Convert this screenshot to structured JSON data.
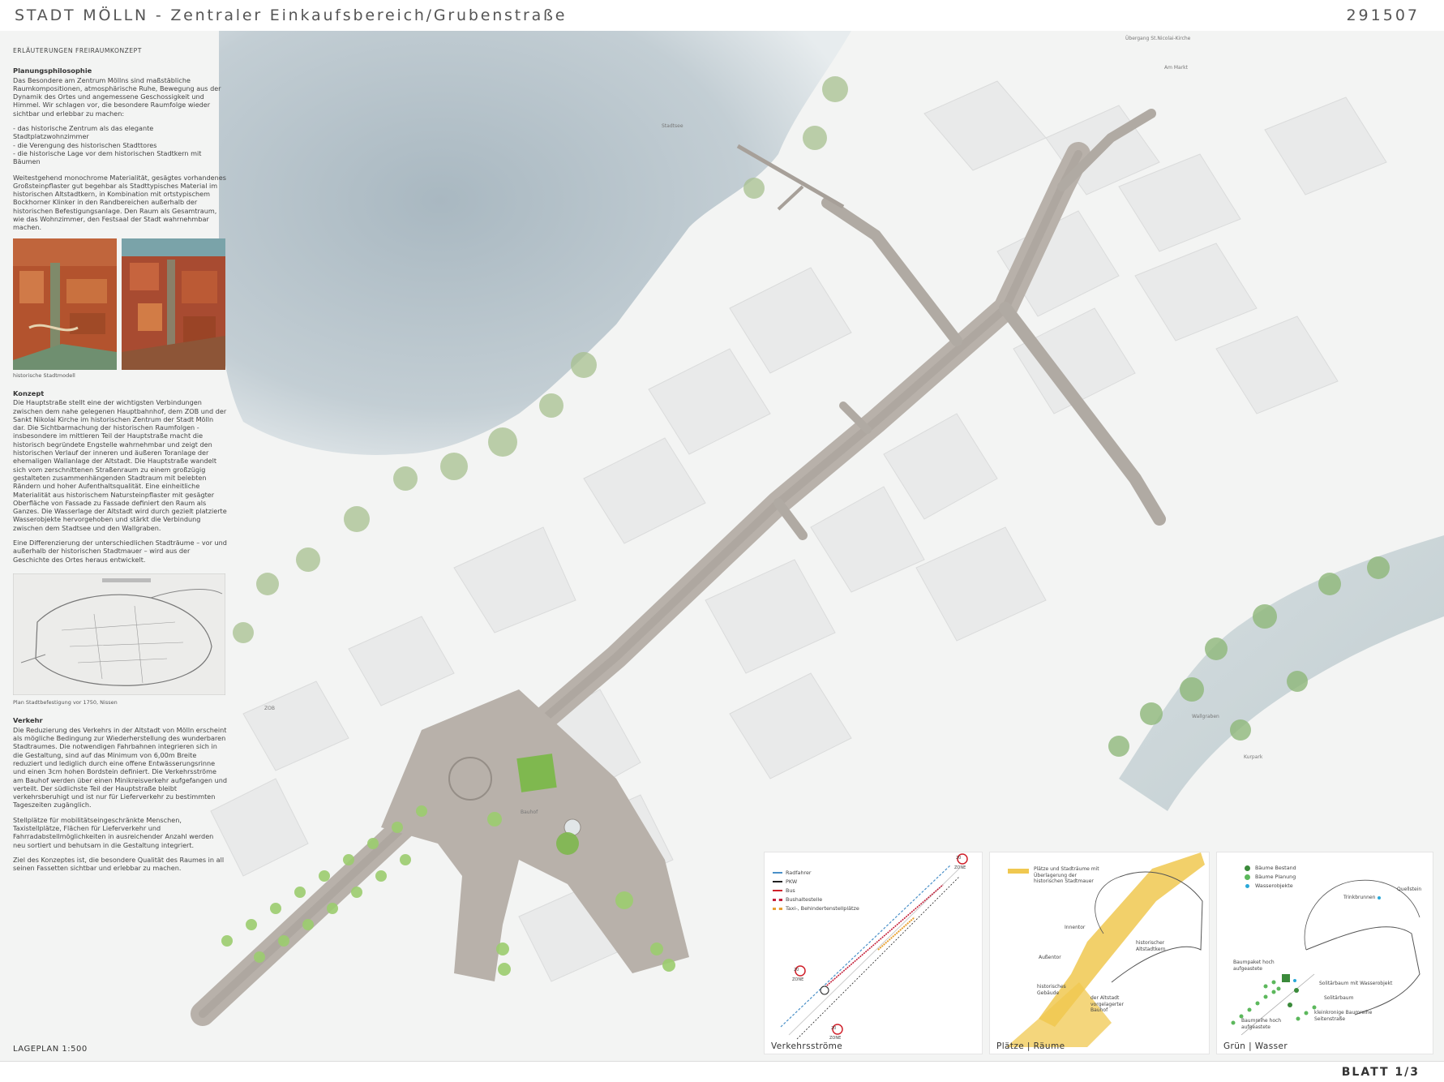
{
  "header": {
    "title": "STADT MÖLLN - Zentraler Einkaufsbereich/Grubenstraße",
    "project_number": "291507"
  },
  "footer": {
    "sheet": "BLATT 1/3",
    "plan_scale": "LAGEPLAN 1:500"
  },
  "text_panel": {
    "section_title": "ERLÄUTERUNGEN FREIRAUMKONZEPT",
    "philosophy_heading": "Planungsphilosophie",
    "philosophy_text": "Das Besondere am Zentrum Möllns sind maßstäbliche Raumkompositionen, atmosphärische Ruhe, Bewegung aus der Dynamik des Ortes und angemessene Geschossigkeit und Himmel. Wir schlagen vor, die besondere Raumfolge wieder sichtbar und erlebbar zu machen:",
    "bullet_1": "- das historische Zentrum als das elegante Stadtplatzwohnzimmer",
    "bullet_2": "- die Verengung des historischen Stadttores",
    "bullet_3": "- die historische Lage vor dem historischen Stadtkern mit Bäumen",
    "material_text": "Weitestgehend monochrome Materialität, gesägtes vorhandenes Großsteinpflaster gut begehbar als Stadttypisches Material im historischen Altstadtkern, in Kombination mit ortstypischem Bockhorner Klinker in den Randbereichen außerhalb der historischen Befestigungsanlage. Den Raum als Gesamtraum, wie das Wohnzimmer, den Festsaal der Stadt wahrnehmbar machen.",
    "photo_caption": "historische Stadtmodell",
    "concept_heading": "Konzept",
    "concept_text": "Die Hauptstraße stellt eine der wichtigsten Verbindungen zwischen dem nahe gelegenen Hauptbahnhof, dem ZOB und der Sankt Nikolai Kirche im historischen Zentrum der Stadt Mölln dar. Die Sichtbarmachung der historischen Raumfolgen - insbesondere im mittleren Teil der Hauptstraße macht die historisch begründete Engstelle wahrnehmbar und zeigt den historischen Verlauf der inneren und äußeren Toranlage der ehemaligen Wallanlage der Altstadt. Die Hauptstraße wandelt sich vom zerschnittenen Straßenraum zu einem großzügig gestalteten zusammenhängenden Stadtraum mit belebten Rändern und hoher Aufenthaltsqualität. Eine einheitliche Materialität aus historischem Natursteinpflaster mit gesägter Oberfläche von Fassade zu Fassade definiert den Raum als Ganzes. Die Wasserlage der Altstadt wird durch gezielt platzierte Wasserobjekte hervorgehoben und stärkt die Verbindung zwischen dem Stadtsee und den Wallgraben.",
    "differentiation_text": "Eine Differenzierung der unterschiedlichen Stadträume – vor und außerhalb der historischen Stadtmauer – wird aus der Geschichte des Ortes heraus entwickelt.",
    "plan_caption": "Plan Stadtbefestigung vor 1750, Nissen",
    "traffic_heading": "Verkehr",
    "traffic_text": "Die Reduzierung des Verkehrs in der Altstadt von Mölln erscheint als mögliche Bedingung zur Wiederherstellung des wunderbaren Stadtraumes. Die notwendigen Fahrbahnen integrieren sich in die Gestaltung, sind auf das Minimum von 6,00m Breite reduziert und lediglich durch eine offene Entwässerungsrinne und einen 3cm hohen Bordstein definiert. Die Verkehrsströme am Bauhof werden über einen Minikreisverkehr aufgefangen und verteilt. Der südlichste Teil der Hauptstraße bleibt verkehrsberuhigt und ist nur für Lieferverkehr zu bestimmten Tageszeiten zugänglich.",
    "parking_text": "Stellplätze für mobilitätseingeschränkte Menschen, Taxistellplätze, Flächen für Lieferverkehr und Fahrradabstellmöglichkeiten in ausreichender Anzahl werden neu sortiert und behutsam in die Gestaltung integriert.",
    "closing_text": "Ziel des Konzeptes ist, die besondere Qualität des Raumes in all seinen Fassetten sichtbar und erlebbar zu machen."
  },
  "map_labels": {
    "crossing": "Übergang St.Nicolai-Kirche",
    "market": "Am Markt",
    "lake": "Stadtsee",
    "zob": "ZOB",
    "bauhof": "Bauhof",
    "wallgraben": "Wallgraben",
    "kurpark": "Kurpark"
  },
  "diagrams": {
    "traffic": {
      "title": "Verkehrsströme",
      "legend": [
        "Radfahrer",
        "PKW",
        "Bus",
        "Bushaltestelle",
        "Taxi-, Behindertenstellplätze"
      ],
      "legend_colors": [
        "#4a90c8",
        "#222222",
        "#d0202a",
        "#c4203a",
        "#e8a030"
      ],
      "zone_number": "20",
      "zone_word": "ZONE"
    },
    "places": {
      "title": "Plätze | Räume",
      "legend": "Plätze und Stadträume mit Überlagerung der historischen Stadtmauer",
      "labels": {
        "inner_gate": "Innentor",
        "outer_gate": "Außentor",
        "historic_core": "historischer Altstadtkern",
        "historic_buildings": "historisches Gebäude",
        "bauhof": "der Altstadt vorgelagerter Bauhof"
      },
      "accent": "#f0c850"
    },
    "green": {
      "title": "Grün | Wasser",
      "legend": [
        "Bäume Bestand",
        "Bäume Planung",
        "Wasserobjekte"
      ],
      "legend_colors": [
        "#3a8a3a",
        "#5cb85c",
        "#2aa8d8"
      ],
      "labels": {
        "fountain": "Trinkbrunnen",
        "spring": "Quellstein",
        "tree_package": "Baumpaket hoch aufgeastete",
        "solitary_water": "Solitärbaum mit Wasserobjekt",
        "solitary": "Solitärbaum",
        "tree_row": "Baumreihe hoch aufgeastete",
        "small_tree_row": "kleinkronige Baumreihe Seitenstraße"
      }
    }
  }
}
